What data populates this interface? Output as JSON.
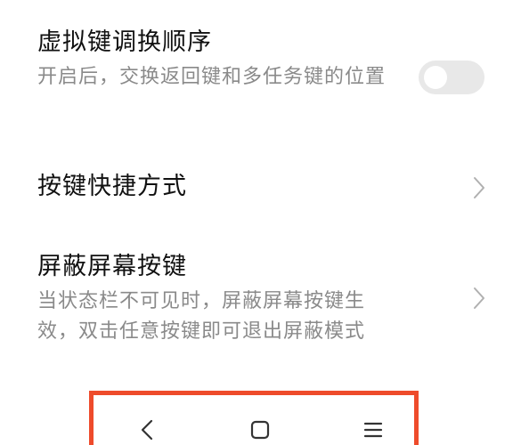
{
  "settings": {
    "swap_keys": {
      "title": "虚拟键调换顺序",
      "description": "开启后，交换返回键和多任务键的位置",
      "toggle_on": false
    },
    "key_shortcuts": {
      "title": "按键快捷方式"
    },
    "mask_keys": {
      "title": "屏蔽屏幕按键",
      "description": "当状态栏不可见时，屏蔽屏幕按键生效，双击任意按键即可退出屏蔽模式"
    }
  },
  "navbar": {
    "highlight_color": "#ee4b2b",
    "buttons": [
      {
        "icon": "back-icon"
      },
      {
        "icon": "home-icon"
      },
      {
        "icon": "menu-icon"
      }
    ]
  }
}
